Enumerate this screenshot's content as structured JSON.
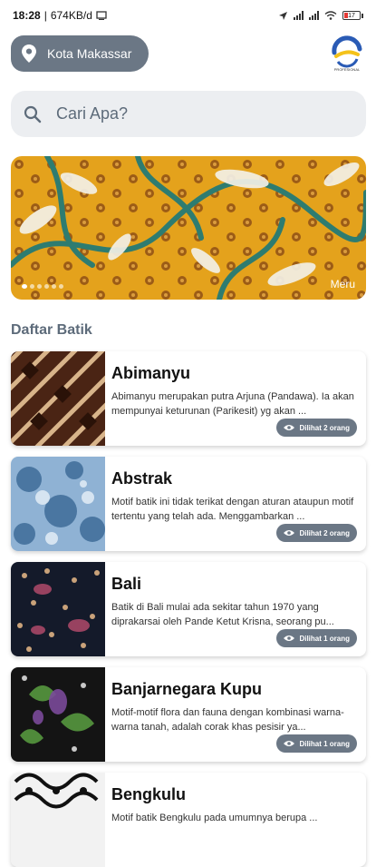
{
  "status_bar": {
    "time": "18:28",
    "speed": "674KB/d",
    "battery_level": "17"
  },
  "location": {
    "label": "Kota Makassar"
  },
  "logo": {
    "text": "PROFESIONAL"
  },
  "search": {
    "placeholder": "Cari Apa?"
  },
  "banner": {
    "caption": "Meru",
    "dots_count": 6,
    "active_dot": 0
  },
  "section": {
    "title": "Daftar Batik"
  },
  "cards": [
    {
      "title": "Abimanyu",
      "description": "Abimanyu merupakan putra Arjuna (Pandawa). Ia akan mempunyai keturunan (Parikesit) yg akan ...",
      "views": "Dilihat 2 orang"
    },
    {
      "title": "Abstrak",
      "description": "Motif batik ini tidak terikat dengan aturan ataupun motif tertentu yang telah ada. Menggambarkan ...",
      "views": "Dilihat 2 orang"
    },
    {
      "title": "Bali",
      "description": "Batik di Bali mulai ada sekitar tahun 1970 yang diprakarsai oleh Pande Ketut Krisna, seorang pu...",
      "views": "Dilihat 1 orang"
    },
    {
      "title": "Banjarnegara Kupu",
      "description": "Motif-motif flora dan fauna dengan kombinasi warna-warna tanah, adalah corak khas pesisir ya...",
      "views": "Dilihat 1 orang"
    },
    {
      "title": "Bengkulu",
      "description": "Motif batik Bengkulu pada umumnya berupa ...",
      "views": ""
    }
  ],
  "colors": {
    "accent": "#6b7785",
    "search_bg": "#eceef1",
    "section_title": "#5d6b7a"
  }
}
